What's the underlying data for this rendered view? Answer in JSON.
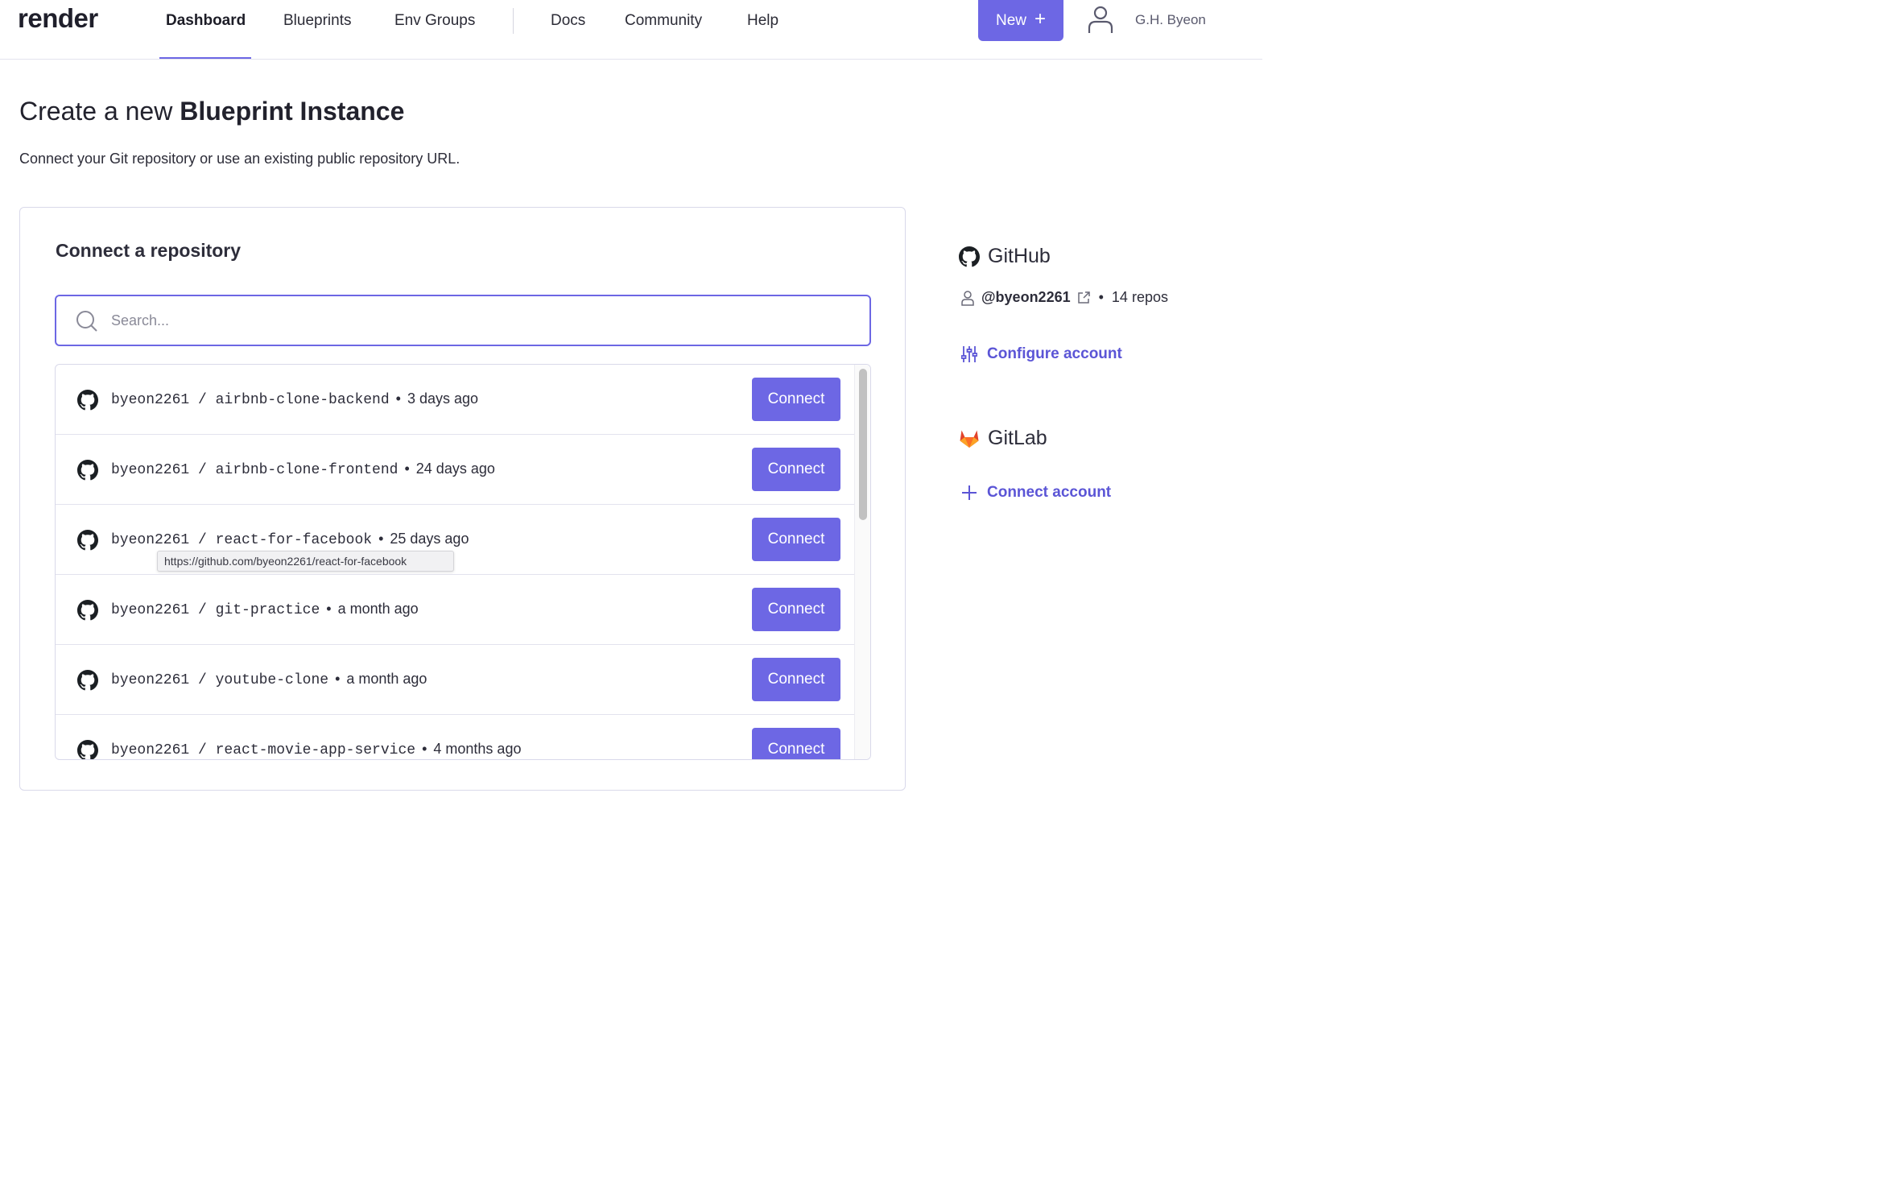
{
  "nav": {
    "logo": "render",
    "items": [
      "Dashboard",
      "Blueprints",
      "Env Groups",
      "Docs",
      "Community",
      "Help"
    ],
    "active": "Dashboard",
    "new_label": "New",
    "user_name": "G.H. Byeon"
  },
  "page": {
    "title_prefix": "Create a new",
    "title_bold": "Blueprint Instance",
    "subtitle": "Connect your Git repository or use an existing public repository URL."
  },
  "card": {
    "title": "Connect a repository",
    "search_placeholder": "Search...",
    "connect_label": "Connect",
    "repos": [
      {
        "owner": "byeon2261",
        "name": "airbnb-clone-backend",
        "updated": "3 days ago"
      },
      {
        "owner": "byeon2261",
        "name": "airbnb-clone-frontend",
        "updated": "24 days ago"
      },
      {
        "owner": "byeon2261",
        "name": "react-for-facebook",
        "updated": "25 days ago"
      },
      {
        "owner": "byeon2261",
        "name": "git-practice",
        "updated": "a month ago"
      },
      {
        "owner": "byeon2261",
        "name": "youtube-clone",
        "updated": "a month ago"
      },
      {
        "owner": "byeon2261",
        "name": "react-movie-app-service",
        "updated": "4 months ago"
      }
    ],
    "tooltip": "https://github.com/byeon2261/react-for-facebook"
  },
  "sidebar": {
    "github": {
      "title": "GitHub",
      "handle": "@byeon2261",
      "repos": "14 repos",
      "configure": "Configure account"
    },
    "gitlab": {
      "title": "GitLab",
      "connect": "Connect account"
    }
  },
  "colors": {
    "accent": "#6d67e4",
    "link": "#5b55d6",
    "gitlab_orange": "#e2432a"
  }
}
